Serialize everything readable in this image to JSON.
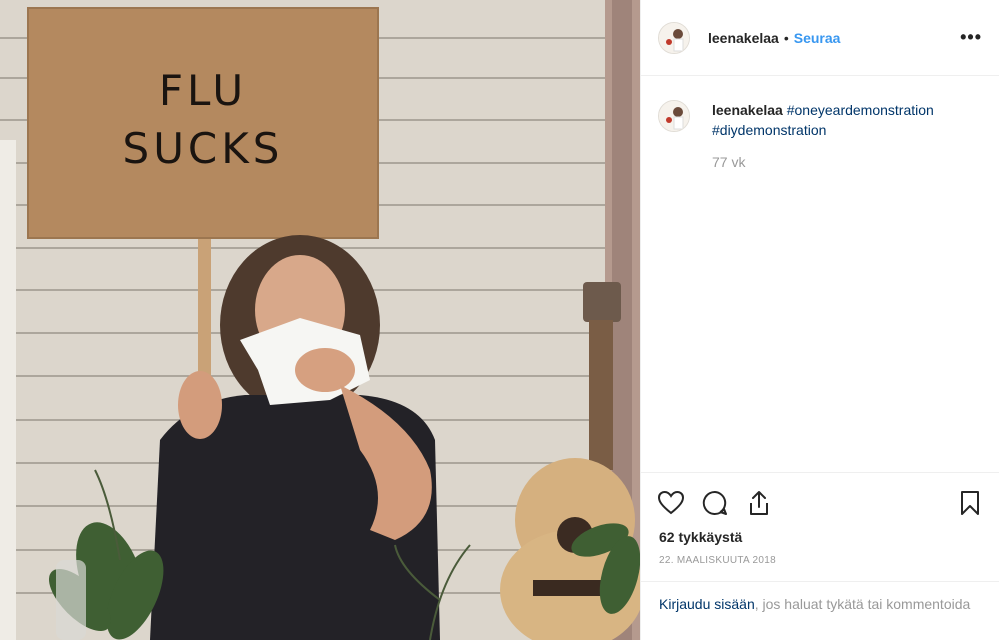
{
  "post": {
    "username": "leenakelaa",
    "separator": "•",
    "follow_label": "Seuraa",
    "more_label": "•••",
    "caption_hashtags": [
      "#oneyeardemonstration",
      "#diydemonstration"
    ],
    "time_ago": "77 vk",
    "likes": "62 tykkäystä",
    "date": "22. MAALISKUUTA 2018"
  },
  "photo": {
    "sign_line1": "FLU",
    "sign_line2": "SUCKS"
  },
  "login_prompt": {
    "link": "Kirjaudu sisään",
    "rest": ", jos haluat tykätä tai kommentoida"
  },
  "icons": {
    "like": "heart-icon",
    "comment": "comment-icon",
    "share": "share-icon",
    "save": "bookmark-icon"
  },
  "colors": {
    "follow": "#3897f0",
    "link": "#003569",
    "muted": "#999999",
    "text": "#262626"
  }
}
